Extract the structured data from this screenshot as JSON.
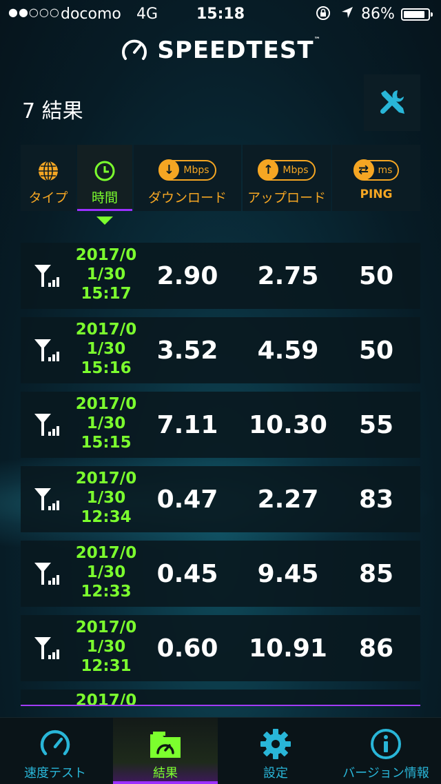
{
  "status_bar": {
    "signal_dots": "●●○○○",
    "carrier": "docomo",
    "network": "4G",
    "time": "15:18",
    "battery_pct": "86%"
  },
  "header": {
    "app_name": "SPEEDTEST",
    "trademark": "™"
  },
  "results": {
    "title": "7 結果"
  },
  "columns": {
    "type": "タイプ",
    "time": "時間",
    "download": "ダウンロード",
    "download_unit": "Mbps",
    "upload": "アップロード",
    "upload_unit": "Mbps",
    "ping": "PING",
    "ping_unit": "ms"
  },
  "rows": [
    {
      "date": "2017/0",
      "day": "1/30",
      "time": "15:17",
      "download": "2.90",
      "upload": "2.75",
      "ping": "50"
    },
    {
      "date": "2017/0",
      "day": "1/30",
      "time": "15:16",
      "download": "3.52",
      "upload": "4.59",
      "ping": "50"
    },
    {
      "date": "2017/0",
      "day": "1/30",
      "time": "15:15",
      "download": "7.11",
      "upload": "10.30",
      "ping": "55"
    },
    {
      "date": "2017/0",
      "day": "1/30",
      "time": "12:34",
      "download": "0.47",
      "upload": "2.27",
      "ping": "83"
    },
    {
      "date": "2017/0",
      "day": "1/30",
      "time": "12:33",
      "download": "0.45",
      "upload": "9.45",
      "ping": "85"
    },
    {
      "date": "2017/0",
      "day": "1/30",
      "time": "12:31",
      "download": "0.60",
      "upload": "10.91",
      "ping": "86"
    },
    {
      "date": "2017/0"
    }
  ],
  "tabs": {
    "speed_test": "速度テスト",
    "results": "結果",
    "settings": "設定",
    "version": "バージョン情報"
  },
  "colors": {
    "accent_green": "#7cff2e",
    "accent_orange": "#f5a623",
    "accent_cyan": "#29b6d8",
    "accent_purple": "#9b30ff"
  },
  "icons": {
    "tools": "wrench-screwdriver-icon",
    "type": "globe-icon",
    "time": "clock-icon",
    "download": "arrow-down-icon",
    "upload": "arrow-up-icon",
    "ping": "ping-arrows-icon",
    "row_type": "cellular-signal-icon",
    "speed_tab": "speedometer-icon",
    "results_tab": "results-folder-icon",
    "settings_tab": "gear-icon",
    "version_tab": "info-icon"
  }
}
